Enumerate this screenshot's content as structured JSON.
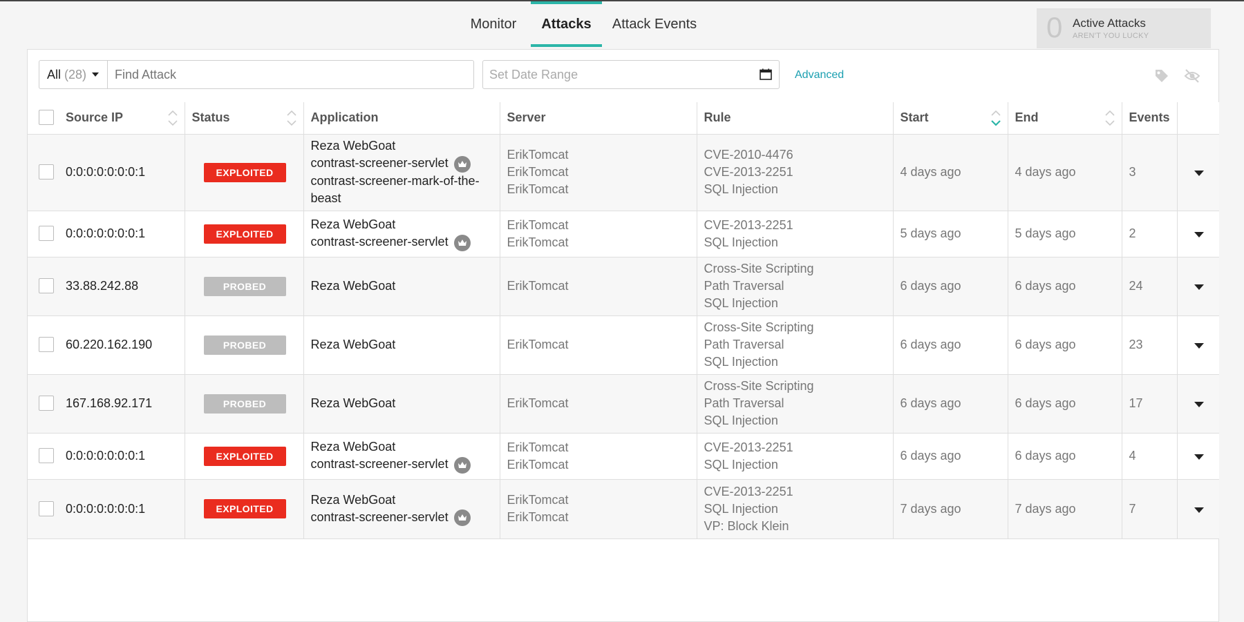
{
  "nav": {
    "tabs": [
      "Monitor",
      "Attacks",
      "Attack Events"
    ],
    "active": "Attacks"
  },
  "active_attacks": {
    "count": "0",
    "title": "Active Attacks",
    "subtitle": "AREN'T YOU LUCKY"
  },
  "filters": {
    "all_label": "All",
    "all_count": "(28)",
    "find_placeholder": "Find Attack",
    "date_placeholder": "Set Date Range",
    "advanced_label": "Advanced"
  },
  "columns": [
    "Source IP",
    "Status",
    "Application",
    "Server",
    "Rule",
    "Start",
    "End",
    "Events"
  ],
  "colors": {
    "accent": "#2cb5a8",
    "exploited": "#ea2c1f",
    "probed": "#bdbdbd",
    "link": "#1a9fb0"
  },
  "rows": [
    {
      "ip": "0:0:0:0:0:0:0:1",
      "status": "EXPLOITED",
      "apps": [
        "Reza WebGoat",
        "contrast-screener-servlet",
        "contrast-screener-mark-of-the-beast"
      ],
      "servers": [
        "ErikTomcat",
        "ErikTomcat",
        "ErikTomcat"
      ],
      "rules": [
        "CVE-2010-4476",
        "CVE-2013-2251",
        "SQL Injection"
      ],
      "start": "4 days ago",
      "end": "4 days ago",
      "events": "3"
    },
    {
      "ip": "0:0:0:0:0:0:0:1",
      "status": "EXPLOITED",
      "apps": [
        "Reza WebGoat",
        "contrast-screener-servlet"
      ],
      "servers": [
        "ErikTomcat",
        "ErikTomcat"
      ],
      "rules": [
        "CVE-2013-2251",
        "SQL Injection"
      ],
      "start": "5 days ago",
      "end": "5 days ago",
      "events": "2"
    },
    {
      "ip": "33.88.242.88",
      "status": "PROBED",
      "apps": [
        "Reza WebGoat"
      ],
      "servers": [
        "ErikTomcat"
      ],
      "rules": [
        "Cross-Site Scripting",
        "Path Traversal",
        "SQL Injection"
      ],
      "start": "6 days ago",
      "end": "6 days ago",
      "events": "24"
    },
    {
      "ip": "60.220.162.190",
      "status": "PROBED",
      "apps": [
        "Reza WebGoat"
      ],
      "servers": [
        "ErikTomcat"
      ],
      "rules": [
        "Cross-Site Scripting",
        "Path Traversal",
        "SQL Injection"
      ],
      "start": "6 days ago",
      "end": "6 days ago",
      "events": "23"
    },
    {
      "ip": "167.168.92.171",
      "status": "PROBED",
      "apps": [
        "Reza WebGoat"
      ],
      "servers": [
        "ErikTomcat"
      ],
      "rules": [
        "Cross-Site Scripting",
        "Path Traversal",
        "SQL Injection"
      ],
      "start": "6 days ago",
      "end": "6 days ago",
      "events": "17"
    },
    {
      "ip": "0:0:0:0:0:0:0:1",
      "status": "EXPLOITED",
      "apps": [
        "Reza WebGoat",
        "contrast-screener-servlet"
      ],
      "servers": [
        "ErikTomcat",
        "ErikTomcat"
      ],
      "rules": [
        "CVE-2013-2251",
        "SQL Injection"
      ],
      "start": "6 days ago",
      "end": "6 days ago",
      "events": "4"
    },
    {
      "ip": "0:0:0:0:0:0:0:1",
      "status": "EXPLOITED",
      "apps": [
        "Reza WebGoat",
        "contrast-screener-servlet"
      ],
      "servers": [
        "ErikTomcat",
        "ErikTomcat"
      ],
      "rules": [
        "CVE-2013-2251",
        "SQL Injection",
        "VP: Block Klein"
      ],
      "start": "7 days ago",
      "end": "7 days ago",
      "events": "7"
    }
  ]
}
